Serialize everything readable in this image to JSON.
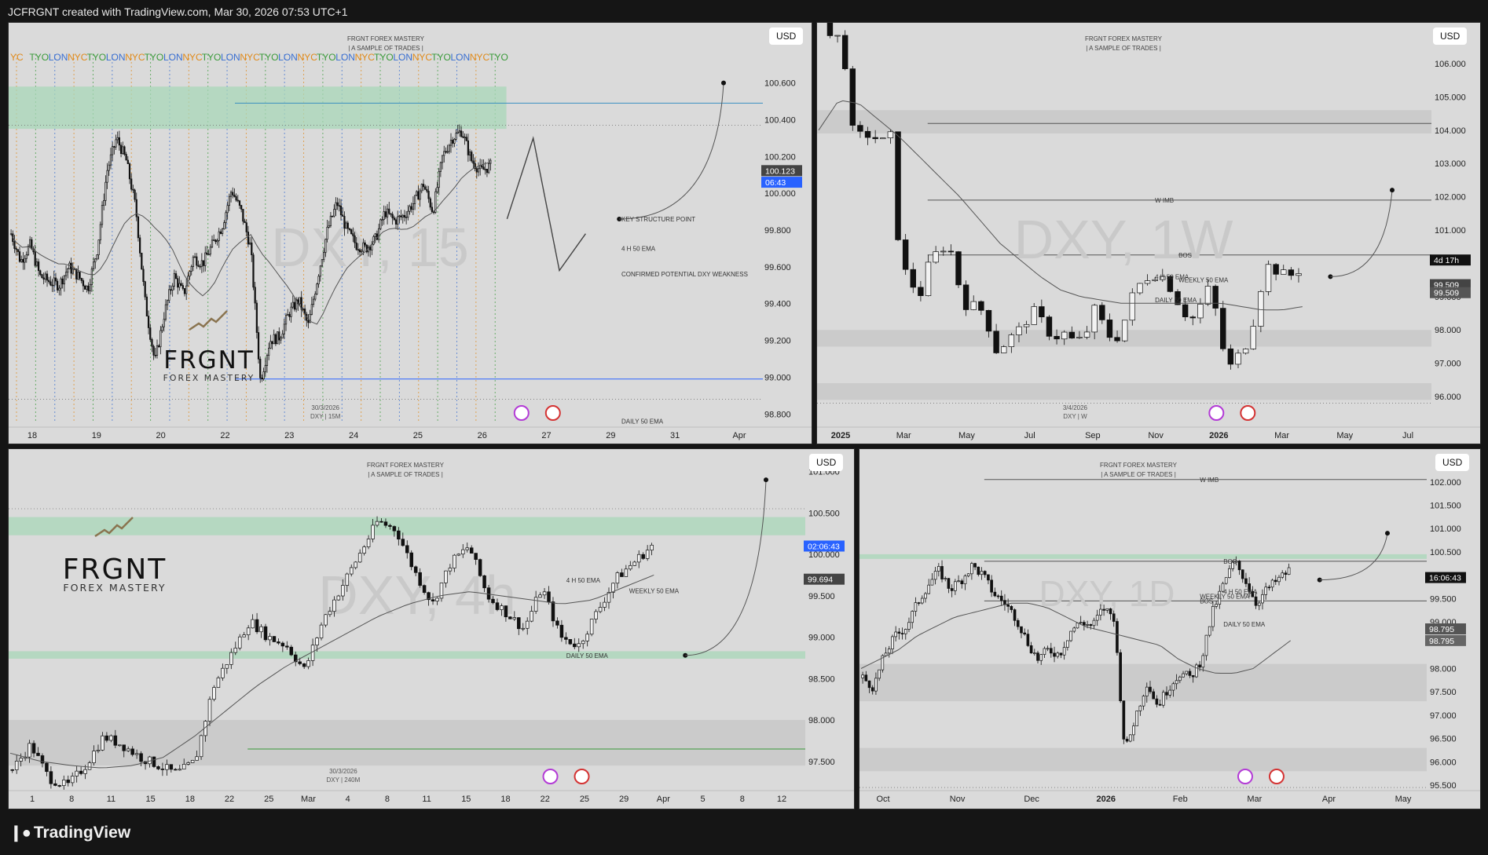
{
  "header": {
    "created_text": "JCFRGNT created with TradingView.com, Mar 30, 2026 07:53 UTC+1"
  },
  "footer": {
    "brand": "TradingView"
  },
  "chart_data": [
    {
      "type": "candlestick",
      "symbol": "DXY",
      "timeframe": "15",
      "watermark": "DXY, 15",
      "header_title": "FRGNT FOREX MASTERY",
      "header_subtitle": "| A SAMPLE OF TRADES |",
      "currency": "USD",
      "x_ticks": [
        "18",
        "19",
        "20",
        "22",
        "23",
        "24",
        "25",
        "26",
        "27",
        "29",
        "31",
        "Apr"
      ],
      "y_ticks": [
        "100.600",
        "100.400",
        "100.200",
        "100.000",
        "99.800",
        "99.600",
        "99.400",
        "99.200",
        "99.000",
        "98.800"
      ],
      "ylim": [
        98.75,
        100.85
      ],
      "session_labels": [
        "YC",
        "TYO",
        "LON",
        "NYC",
        "TYO",
        "LON",
        "NYC",
        "TYO",
        "LON",
        "NYC",
        "TYO",
        "LON",
        "NYC",
        "TYO",
        "LON",
        "NYC",
        "TYO",
        "LON",
        "NYC",
        "TYO",
        "LON",
        "NYC",
        "TYO",
        "LON",
        "NYC",
        "TYO"
      ],
      "session_colors": {
        "TYO": "#3a9a3a",
        "LON": "#3a6fd1",
        "NYC": "#e08a1a",
        "YC": "#e08a1a"
      },
      "price_labels": [
        {
          "text": "100.123",
          "value": 100.123,
          "color": "#444444"
        },
        {
          "text": "06:43",
          "value": 100.06,
          "color": "#2962ff"
        }
      ],
      "annotations": [
        {
          "text": "KEY STRUCTURE POINT",
          "value": 99.86
        },
        {
          "text": "4 H 50 EMA",
          "value": 99.7
        },
        {
          "text": "CONFIRMED POTENTIAL DXY WEAKNESS",
          "value": 99.56
        },
        {
          "text": "DAILY 50 EMA",
          "value": 98.76
        }
      ],
      "zones": [
        {
          "kind": "supply",
          "from": 100.35,
          "to": 100.58,
          "color": "#a8d7b8"
        }
      ],
      "bottom_label": "30/3/2026",
      "bottom_sublabel": "DXY | 15M",
      "series_closes": [
        99.78,
        99.63,
        99.72,
        99.55,
        99.52,
        99.5,
        99.6,
        99.55,
        99.48,
        99.7,
        100.12,
        100.3,
        100.18,
        99.92,
        99.4,
        99.08,
        99.35,
        99.55,
        99.45,
        99.65,
        99.62,
        99.72,
        99.82,
        100.02,
        99.9,
        99.7,
        98.98,
        99.2,
        99.22,
        99.35,
        99.42,
        99.28,
        99.55,
        99.8,
        99.95,
        99.8,
        99.72,
        99.7,
        99.75,
        99.9,
        99.85,
        99.88,
        99.95,
        100.05,
        99.9,
        100.2,
        100.3,
        100.34,
        100.18,
        100.12,
        100.15
      ],
      "projection": [
        99.86,
        100.3,
        99.58,
        99.78
      ],
      "sr_lines": [
        {
          "value": 100.49,
          "color": "#3a8fc0"
        },
        {
          "value": 98.99,
          "color": "#2962ff"
        }
      ],
      "dotted_levels": [
        100.37,
        98.88
      ]
    },
    {
      "type": "candlestick",
      "symbol": "DXY",
      "timeframe": "1W",
      "watermark": "DXY, 1W",
      "header_title": "FRGNT FOREX MASTERY",
      "header_subtitle": "| A SAMPLE OF TRADES |",
      "currency": "USD",
      "x_ticks": [
        "2025",
        "Mar",
        "May",
        "Jul",
        "Sep",
        "Nov",
        "2026",
        "Mar",
        "May",
        "Jul"
      ],
      "y_ticks": [
        "106.000",
        "105.000",
        "104.000",
        "103.000",
        "102.000",
        "101.000",
        "99.000",
        "98.000",
        "97.000",
        "96.000"
      ],
      "ylim": [
        95.2,
        106.8
      ],
      "price_labels": [
        {
          "text": "4d 17h",
          "value": 100.1,
          "color": "#111111"
        },
        {
          "text": "99.509",
          "value": 99.36,
          "color": "#444444"
        },
        {
          "text": "99.509",
          "value": 99.12,
          "color": "#555555"
        }
      ],
      "annotations": [
        {
          "text": "W IMB",
          "value": 101.9
        },
        {
          "text": "BOS",
          "value": 100.25
        },
        {
          "text": "4 H 50 EMA",
          "value": 99.6
        },
        {
          "text": "WEEKLY 50 EMA",
          "value": 99.5
        },
        {
          "text": "DAILY 50 EMA",
          "value": 98.9
        }
      ],
      "zones": [
        {
          "kind": "imbalance",
          "from": 103.9,
          "to": 104.6,
          "color": "#c6c6c6"
        },
        {
          "kind": "demand",
          "from": 95.9,
          "to": 96.4,
          "color": "#c6c6c6"
        },
        {
          "kind": "demand",
          "from": 97.5,
          "to": 98.0,
          "color": "#c6c6c6"
        }
      ],
      "bottom_label": "3/4/2026",
      "bottom_sublabel": "DXY | W",
      "series_closes": [
        108.0,
        106.5,
        107.0,
        104.0,
        103.8,
        103.9,
        103.6,
        103.8,
        100.0,
        99.5,
        99.0,
        100.0,
        100.4,
        100.6,
        99.4,
        98.6,
        98.8,
        98.2,
        97.3,
        97.7,
        97.9,
        98.3,
        98.6,
        98.0,
        97.8,
        97.9,
        97.6,
        97.8,
        98.6,
        98.1,
        97.6,
        98.2,
        99.1,
        99.5,
        99.7,
        99.6,
        99.2,
        98.6,
        98.3,
        98.8,
        99.4,
        97.6,
        96.9,
        97.3,
        97.8,
        99.2,
        100.0,
        99.7,
        99.6,
        99.8
      ],
      "ema": [
        104.0,
        104.9,
        104.8,
        104.3,
        103.8,
        103.2,
        102.6,
        102.0,
        101.3,
        100.6,
        100.1,
        99.6,
        99.2,
        99.0,
        98.9,
        98.8,
        98.8,
        98.8,
        98.8,
        98.8,
        98.8,
        98.7,
        98.6,
        98.6,
        98.7
      ],
      "projection": [
        99.6,
        102.2
      ],
      "sr_lines": [
        {
          "value": 101.9,
          "color": "#555555"
        },
        {
          "value": 100.25,
          "color": "#555555"
        },
        {
          "value": 104.2,
          "color": "#555555"
        }
      ],
      "dotted_levels": [
        95.8
      ]
    },
    {
      "type": "candlestick",
      "symbol": "DXY",
      "timeframe": "4h",
      "watermark": "DXY, 4h",
      "header_title": "FRGNT FOREX MASTERY",
      "header_subtitle": "| A SAMPLE OF TRADES |",
      "currency": "USD",
      "x_ticks": [
        "1",
        "8",
        "11",
        "15",
        "18",
        "22",
        "25",
        "Mar",
        "4",
        "8",
        "11",
        "15",
        "18",
        "22",
        "25",
        "29",
        "Apr",
        "5",
        "8",
        "12"
      ],
      "y_ticks": [
        "101.000",
        "100.500",
        "100.000",
        "99.500",
        "99.000",
        "98.500",
        "98.000",
        "97.500"
      ],
      "ylim": [
        97.1,
        101.1
      ],
      "price_labels": [
        {
          "text": "02:06:43",
          "value": 100.1,
          "color": "#2962ff"
        },
        {
          "text": "99.694",
          "value": 99.7,
          "color": "#444444"
        }
      ],
      "annotations": [
        {
          "text": "4 H 50 EMA",
          "value": 99.69
        },
        {
          "text": "WEEKLY 50 EMA",
          "value": 99.56
        },
        {
          "text": "DAILY 50 EMA",
          "value": 98.78
        }
      ],
      "zones": [
        {
          "kind": "supply",
          "from": 100.23,
          "to": 100.45,
          "color": "#a8d7b8"
        },
        {
          "kind": "demand",
          "from": 98.74,
          "to": 98.83,
          "color": "#a8d7b8"
        },
        {
          "kind": "demand",
          "from": 97.45,
          "to": 98.0,
          "color": "#c6c6c6"
        }
      ],
      "bottom_label": "30/3/2026",
      "bottom_sublabel": "DXY | 240M",
      "series_closes": [
        97.4,
        97.7,
        97.3,
        97.2,
        97.45,
        97.8,
        97.7,
        97.55,
        97.45,
        97.35,
        97.5,
        98.4,
        98.8,
        99.2,
        99.0,
        98.9,
        98.6,
        99.2,
        99.6,
        100.0,
        100.4,
        100.3,
        99.8,
        99.4,
        99.9,
        100.1,
        99.5,
        99.3,
        99.1,
        99.6,
        99.0,
        98.9,
        99.3,
        99.7,
        99.9,
        100.1
      ],
      "ema": [
        97.6,
        97.5,
        97.45,
        97.42,
        97.45,
        97.55,
        97.8,
        98.1,
        98.4,
        98.65,
        98.85,
        99.05,
        99.25,
        99.4,
        99.5,
        99.55,
        99.5,
        99.45,
        99.4,
        99.45,
        99.6,
        99.75
      ],
      "projection": [
        98.78,
        100.9
      ],
      "sr_lines": [
        {
          "value": 97.65,
          "color": "#3a9a3a"
        }
      ],
      "dotted_levels": [
        100.55
      ]
    },
    {
      "type": "candlestick",
      "symbol": "DXY",
      "timeframe": "1D",
      "watermark": "DXY, 1D",
      "header_title": "FRGNT FOREX MASTERY",
      "header_subtitle": "| A SAMPLE OF TRADES |",
      "currency": "USD",
      "x_ticks": [
        "Oct",
        "Nov",
        "Dec",
        "2026",
        "Feb",
        "Mar",
        "Apr",
        "May"
      ],
      "y_ticks": [
        "102.000",
        "101.500",
        "101.000",
        "100.500",
        "99.500",
        "99.000",
        "98.000",
        "97.500",
        "97.000",
        "96.500",
        "96.000",
        "95.500"
      ],
      "ylim": [
        95.3,
        102.4
      ],
      "price_labels": [
        {
          "text": "16:06:43",
          "value": 99.95,
          "color": "#111111"
        },
        {
          "text": "98.795",
          "value": 98.85,
          "color": "#555555"
        },
        {
          "text": "98.795",
          "value": 98.6,
          "color": "#666666"
        }
      ],
      "annotations": [
        {
          "text": "W IMB",
          "value": 102.05
        },
        {
          "text": "BOS",
          "value": 100.3
        },
        {
          "text": "BOS",
          "value": 99.45
        },
        {
          "text": "4 H 50 EMA",
          "value": 99.65
        },
        {
          "text": "WEEKLY 50 EMA",
          "value": 99.55
        },
        {
          "text": "DAILY 50 EMA",
          "value": 98.95
        }
      ],
      "zones": [
        {
          "kind": "supply",
          "from": 100.35,
          "to": 100.45,
          "color": "#a8d7b8"
        },
        {
          "kind": "demand",
          "from": 97.3,
          "to": 98.1,
          "color": "#c6c6c6"
        },
        {
          "kind": "demand",
          "from": 95.8,
          "to": 96.3,
          "color": "#c6c6c6"
        }
      ],
      "series_closes": [
        97.8,
        97.6,
        98.3,
        98.7,
        98.9,
        99.4,
        99.8,
        100.1,
        99.7,
        99.9,
        100.2,
        100.0,
        99.6,
        99.4,
        99.1,
        98.6,
        98.2,
        98.4,
        98.3,
        98.8,
        99.0,
        98.9,
        99.3,
        99.1,
        96.2,
        97.0,
        97.7,
        97.2,
        97.6,
        97.9,
        97.8,
        98.2,
        99.2,
        99.8,
        100.3,
        99.9,
        99.4,
        99.7,
        99.9,
        100.1
      ],
      "ema": [
        98.0,
        98.2,
        98.4,
        98.7,
        98.9,
        99.1,
        99.2,
        99.3,
        99.4,
        99.4,
        99.3,
        99.1,
        98.9,
        98.8,
        98.7,
        98.6,
        98.5,
        98.2,
        98.0,
        97.9,
        97.9,
        98.0,
        98.3,
        98.6
      ],
      "projection": [
        99.9,
        100.9
      ],
      "sr_lines": [
        {
          "value": 102.05,
          "color": "#555555"
        },
        {
          "value": 100.3,
          "color": "#555555"
        },
        {
          "value": 99.45,
          "color": "#555555"
        }
      ],
      "dotted_levels": [
        95.45
      ]
    }
  ],
  "logo": {
    "word": "FRGNT",
    "sub": "FOREX MASTERY",
    "color": "#8a7450"
  }
}
